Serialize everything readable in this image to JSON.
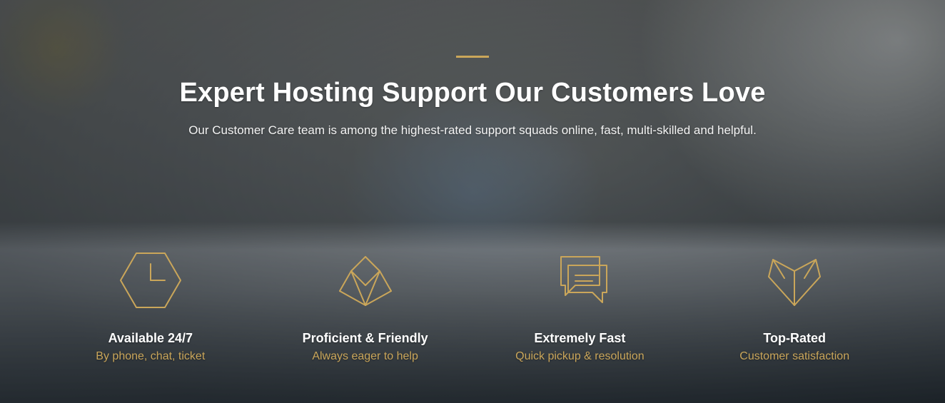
{
  "hero": {
    "title": "Expert Hosting Support Our Customers Love",
    "subtitle": "Our Customer Care team is among the highest-rated support squads online, fast, multi-skilled and helpful."
  },
  "features": [
    {
      "icon": "hex-clock-icon",
      "title": "Available 24/7",
      "subtitle": "By phone, chat, ticket"
    },
    {
      "icon": "origami-crown-icon",
      "title": "Proficient & Friendly",
      "subtitle": "Always eager to help"
    },
    {
      "icon": "chat-bubbles-icon",
      "title": "Extremely Fast",
      "subtitle": "Quick pickup & resolution"
    },
    {
      "icon": "origami-heart-icon",
      "title": "Top-Rated",
      "subtitle": "Customer satisfaction"
    }
  ],
  "colors": {
    "accent": "#caa65a"
  }
}
